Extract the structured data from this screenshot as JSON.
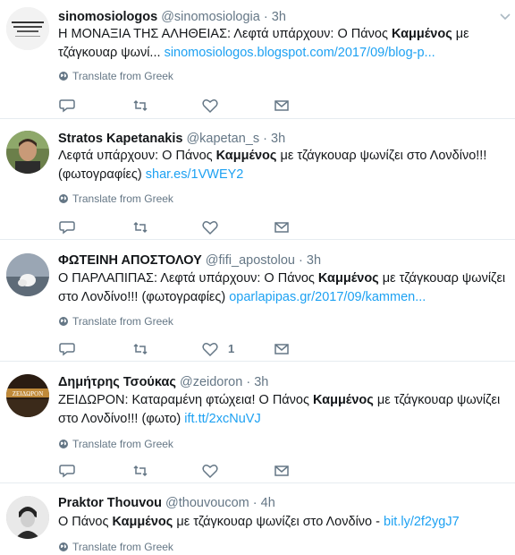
{
  "translate_label": "Translate from Greek",
  "tweets": [
    {
      "name": "sinomosiologos",
      "handle": "@sinomosiologia",
      "time": "3h",
      "line1_pre": "Η ΜΟΝΑΞΙΑ ΤΗΣ ΑΛΗΘΕΙΑΣ: Λεφτά υπάρχουν: Ο Πάνος ",
      "line1_bold": "Καμμένος",
      "line1_post": " με",
      "line2_pre": "τζάγκουαρ ψωνί... ",
      "line2_bold": "",
      "line2_post": "",
      "link": "sinomosiologos.blogspot.com/2017/09/blog-p...",
      "likes": ""
    },
    {
      "name": "Stratos Kapetanakis",
      "handle": "@kapetan_s",
      "time": "3h",
      "line1_pre": "Λεφτά υπάρχουν: Ο Πάνος ",
      "line1_bold": "Καμμένος",
      "line1_post": " με τζάγκουαρ ψωνίζει στο Λονδίνο!!!",
      "line2_pre": "(φωτογραφίες) ",
      "line2_bold": "",
      "line2_post": "",
      "link": "shar.es/1VWEY2",
      "likes": ""
    },
    {
      "name": "ΦΩΤΕΙΝΗ ΑΠΟΣΤΟΛΟΥ",
      "handle": "@fifi_apostolou",
      "time": "3h",
      "line1_pre": "Ο ΠΑΡΛΑΠΙΠΑΣ: Λεφτά υπάρχουν: Ο Πάνος ",
      "line1_bold": "Καμμένος",
      "line1_post": " με τζάγκουαρ ψωνίζει",
      "line2_pre": "στο Λονδίνο!!! (φωτογραφίες) ",
      "line2_bold": "",
      "line2_post": "",
      "link": "oparlapipas.gr/2017/09/kammen...",
      "likes": "1"
    },
    {
      "name": "Δημήτρης Τσούκας",
      "handle": "@zeidoron",
      "time": "3h",
      "line1_pre": "ΖΕΙΔΩΡΟΝ: Καταραμένη φτώχεια! Ο Πάνος ",
      "line1_bold": "Καμμένος",
      "line1_post": " με τζάγκουαρ ψωνίζει",
      "line2_pre": "στο Λονδίνο!!! (φωτο) ",
      "line2_bold": "",
      "line2_post": "",
      "link": "ift.tt/2xcNuVJ",
      "likes": ""
    },
    {
      "name": "Praktor Thouvou",
      "handle": "@thouvoucom",
      "time": "4h",
      "line1_pre": "Ο Πάνος ",
      "line1_bold": "Καμμένος",
      "line1_post": " με τζάγκουαρ ψωνίζει στο Λονδίνο - ",
      "line1_link": "bit.ly/2f2ygJ7",
      "line2_pre": "",
      "line2_bold": "",
      "line2_post": "",
      "link": "",
      "likes": ""
    }
  ],
  "colors": {
    "link": "#1da1f2",
    "muted": "#657786",
    "divider": "#e6ecf0"
  }
}
